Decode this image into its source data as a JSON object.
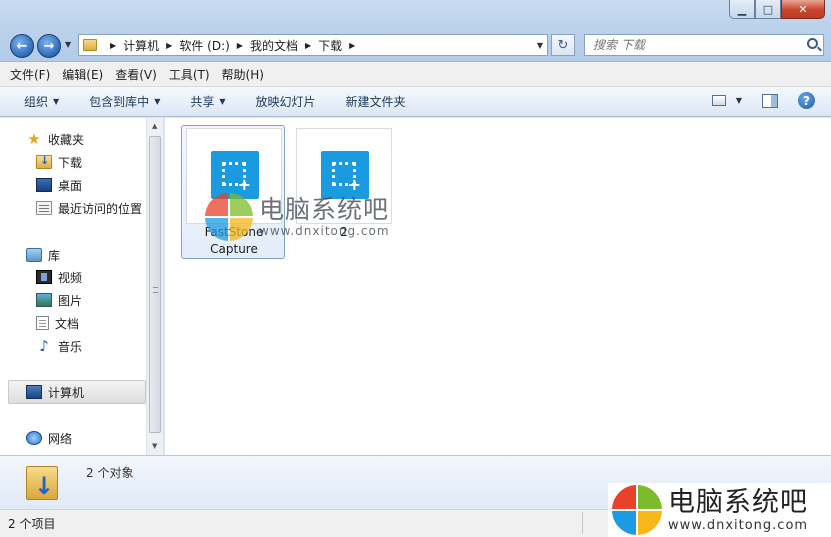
{
  "window": {
    "minimize": "▁",
    "maximize": "□",
    "close": "✕"
  },
  "address": {
    "crumbs": [
      "计算机",
      "软件 (D:)",
      "我的文档",
      "下载"
    ]
  },
  "search": {
    "placeholder": "搜索 下载"
  },
  "menu": [
    "文件(F)",
    "编辑(E)",
    "查看(V)",
    "工具(T)",
    "帮助(H)"
  ],
  "toolbar": {
    "organize": "组织",
    "include_in_library": "包含到库中",
    "share": "共享",
    "slideshow": "放映幻灯片",
    "new_folder": "新建文件夹",
    "help": "?"
  },
  "sidebar": {
    "favorites": "收藏夹",
    "downloads": "下载",
    "desktop": "桌面",
    "recent": "最近访问的位置",
    "libraries": "库",
    "videos": "视频",
    "pictures": "图片",
    "documents": "文档",
    "music": "音乐",
    "computer": "计算机",
    "network": "网络"
  },
  "files": [
    {
      "name_line1": "FastStone",
      "name_line2": "Capture",
      "selected": true
    },
    {
      "name_line1": "2",
      "name_line2": "",
      "selected": false
    }
  ],
  "details": {
    "count": "2 个对象"
  },
  "status": {
    "items": "2 个项目"
  },
  "watermark": {
    "title": "电脑系统吧",
    "url": "www.dnxitong.com"
  },
  "colors": {
    "app_icon": "#1a9be0",
    "selection_border": "#7da2ce",
    "logo_red": "#e8412c",
    "logo_green": "#7cbb2a",
    "logo_blue": "#1d9ae0",
    "logo_yellow": "#f7b81c"
  }
}
